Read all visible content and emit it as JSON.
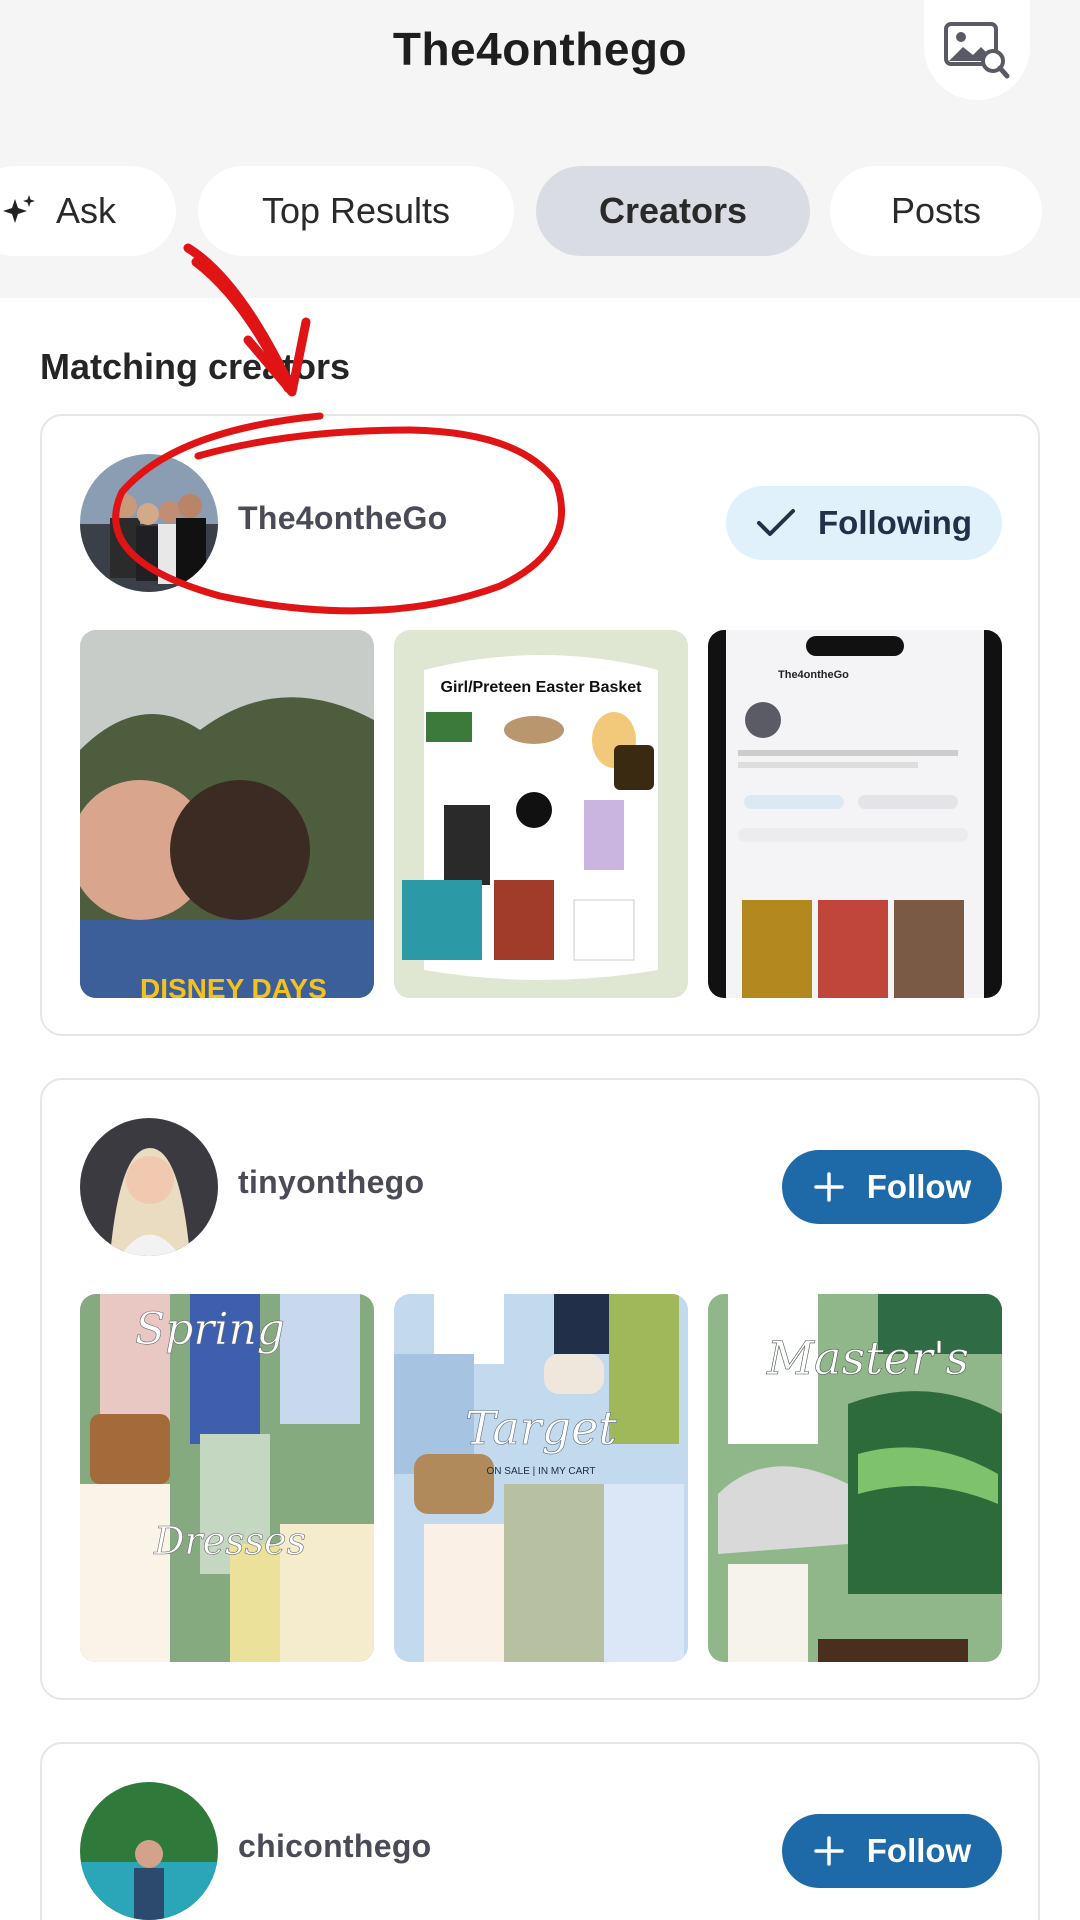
{
  "header": {
    "title": "The4onthego",
    "image_search_icon": "image-search-icon"
  },
  "tabs": [
    {
      "label": "Ask",
      "icon": "sparkle-icon",
      "active": false
    },
    {
      "label": "Top Results",
      "active": false
    },
    {
      "label": "Creators",
      "active": true
    },
    {
      "label": "Posts",
      "active": false
    }
  ],
  "section": {
    "title": "Matching creators"
  },
  "creators": [
    {
      "name": "The4ontheGo",
      "button": "Following",
      "button_icon": "checkmark-icon",
      "posts": [
        {
          "caption": "DISNEY DAYS"
        },
        {
          "caption": "Girl/Preteen Easter Basket"
        },
        {
          "caption": "The4ontheGo"
        }
      ]
    },
    {
      "name": "tinyonthego",
      "button": "Follow",
      "button_icon": "plus-icon",
      "posts": [
        {
          "caption": "Spring",
          "caption2": "Dresses"
        },
        {
          "caption": "Target",
          "caption2": "ON SALE | IN MY CART"
        },
        {
          "caption": "Master's"
        }
      ]
    },
    {
      "name": "chiconthego",
      "button": "Follow",
      "button_icon": "plus-icon"
    }
  ],
  "colors": {
    "accent": "#1e69a7",
    "following_bg": "#e1f1fb",
    "annotation": "#e01414",
    "tab_active": "#d9dde3"
  }
}
